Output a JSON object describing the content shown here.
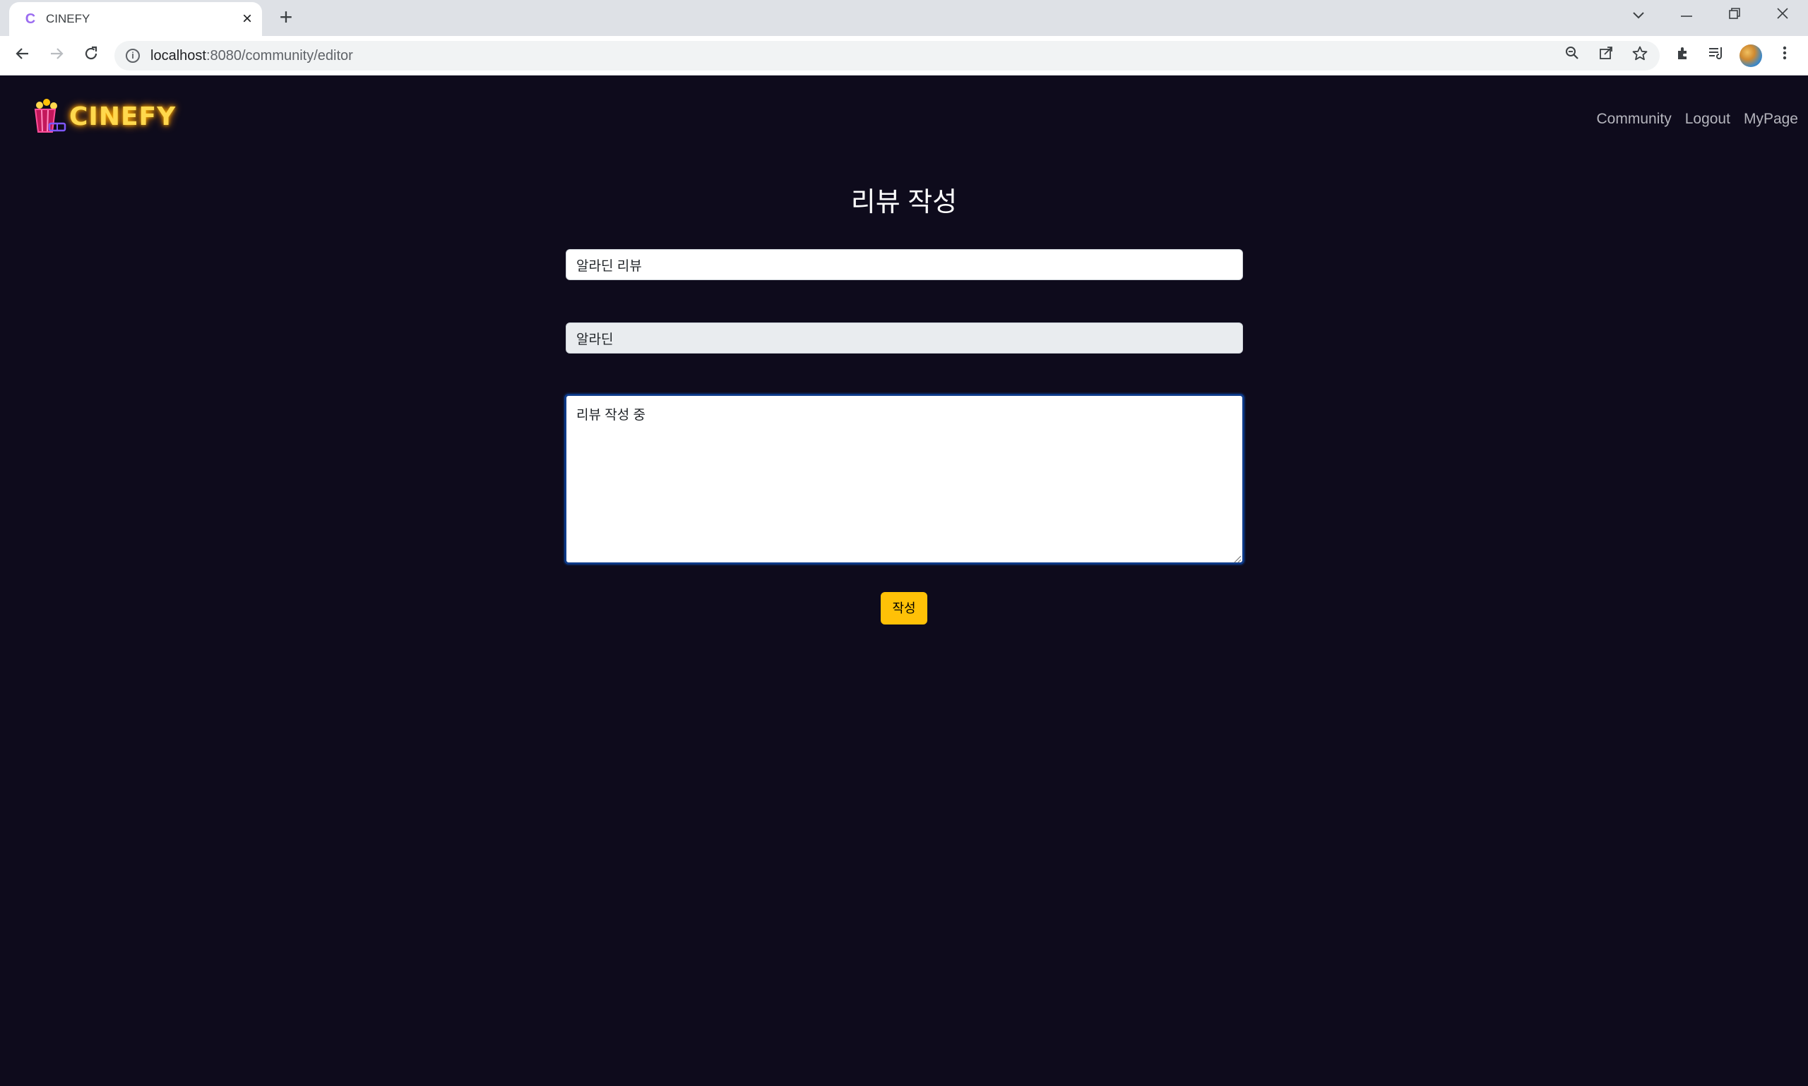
{
  "browser": {
    "tab_title": "CINEFY",
    "tab_favicon": "C",
    "url_host": "localhost",
    "url_path": ":8080/community/editor",
    "icons": [
      "back-icon",
      "forward-icon",
      "reload-icon",
      "info-icon",
      "zoom-icon",
      "share-icon",
      "bookmark-star-icon",
      "extensions-icon",
      "reading-list-icon",
      "profile-avatar",
      "more-menu-icon"
    ]
  },
  "header": {
    "logo_text": "CINEFY",
    "nav": {
      "community": "Community",
      "logout": "Logout",
      "mypage": "MyPage"
    }
  },
  "editor": {
    "heading": "리뷰 작성",
    "title_value": "알라딘 리뷰",
    "movie_value": "알라딘",
    "content_value": "리뷰 작성 중",
    "submit_label": "작성"
  },
  "colors": {
    "page_background": "#0e0b1c",
    "submit_button": "#ffc107",
    "logo_glow": "#ffd84d",
    "textarea_focus_border": "#0d3a88"
  }
}
